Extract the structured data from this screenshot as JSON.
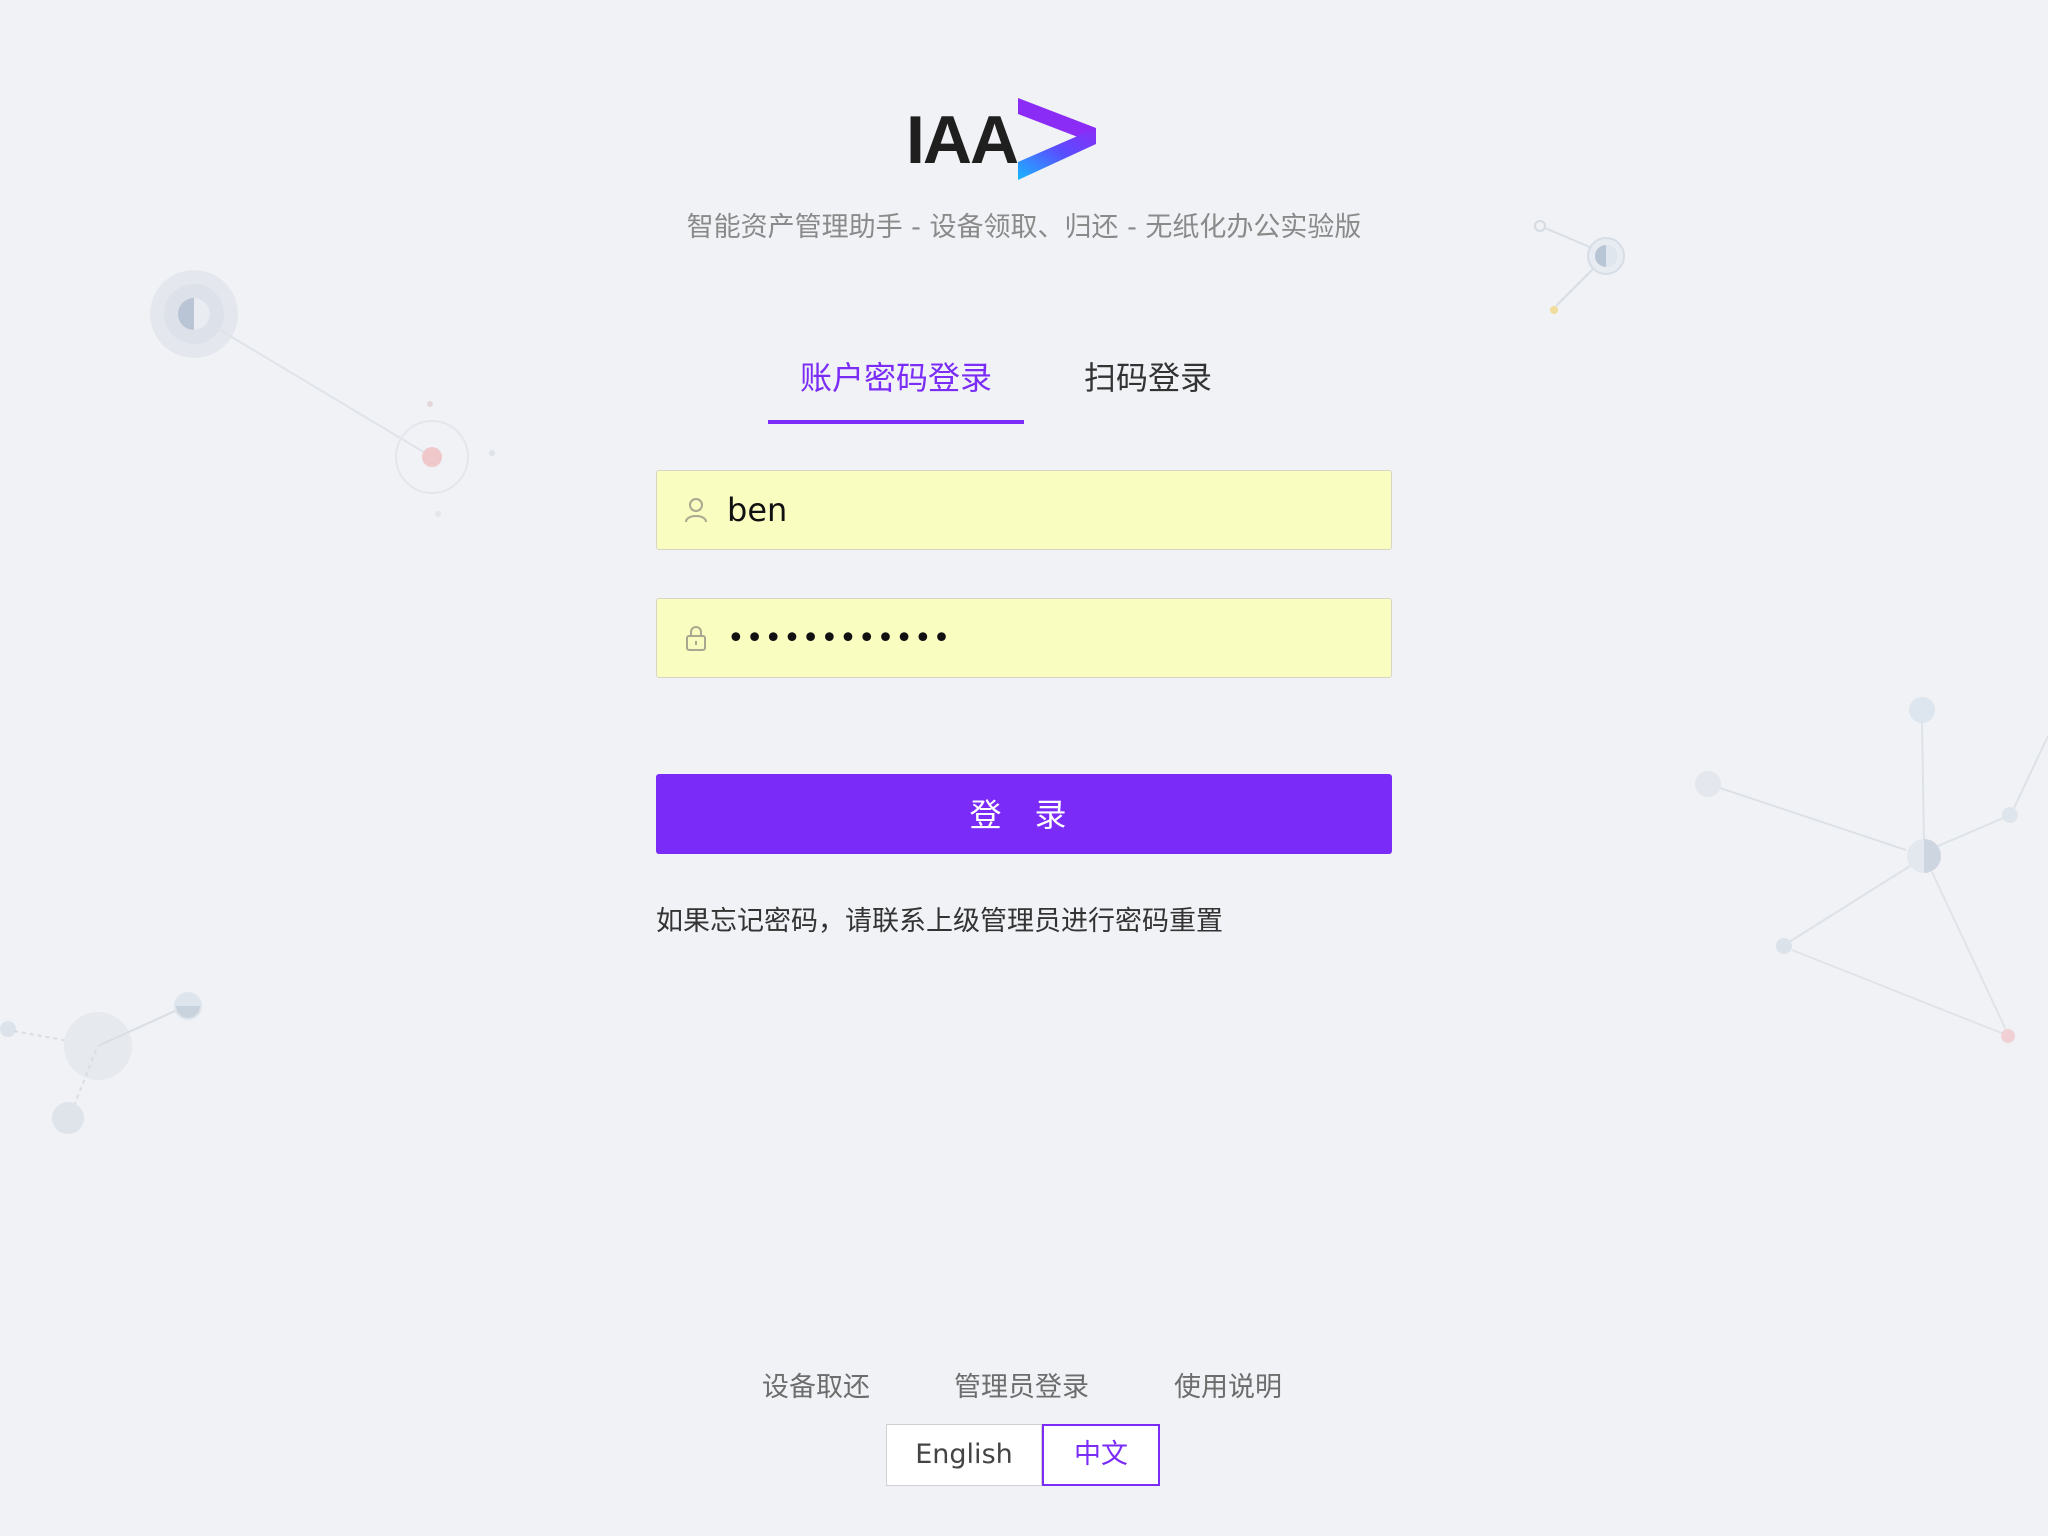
{
  "brand": {
    "logo_text": "IAA",
    "subtitle": "智能资产管理助手 - 设备领取、归还 - 无纸化办公实验版",
    "accent_color": "#7a2bf7"
  },
  "tabs": [
    {
      "label": "账户密码登录",
      "active": true
    },
    {
      "label": "扫码登录",
      "active": false
    }
  ],
  "form": {
    "username": {
      "value": "ben",
      "icon": "user-icon"
    },
    "password": {
      "value": "••••••••••••",
      "icon": "lock-icon"
    },
    "submit_label": "登 录"
  },
  "hint": "如果忘记密码，请联系上级管理员进行密码重置",
  "footer": {
    "links": [
      "设备取还",
      "管理员登录",
      "使用说明"
    ],
    "languages": [
      {
        "label": "English",
        "active": false
      },
      {
        "label": "中文",
        "active": true
      }
    ]
  }
}
